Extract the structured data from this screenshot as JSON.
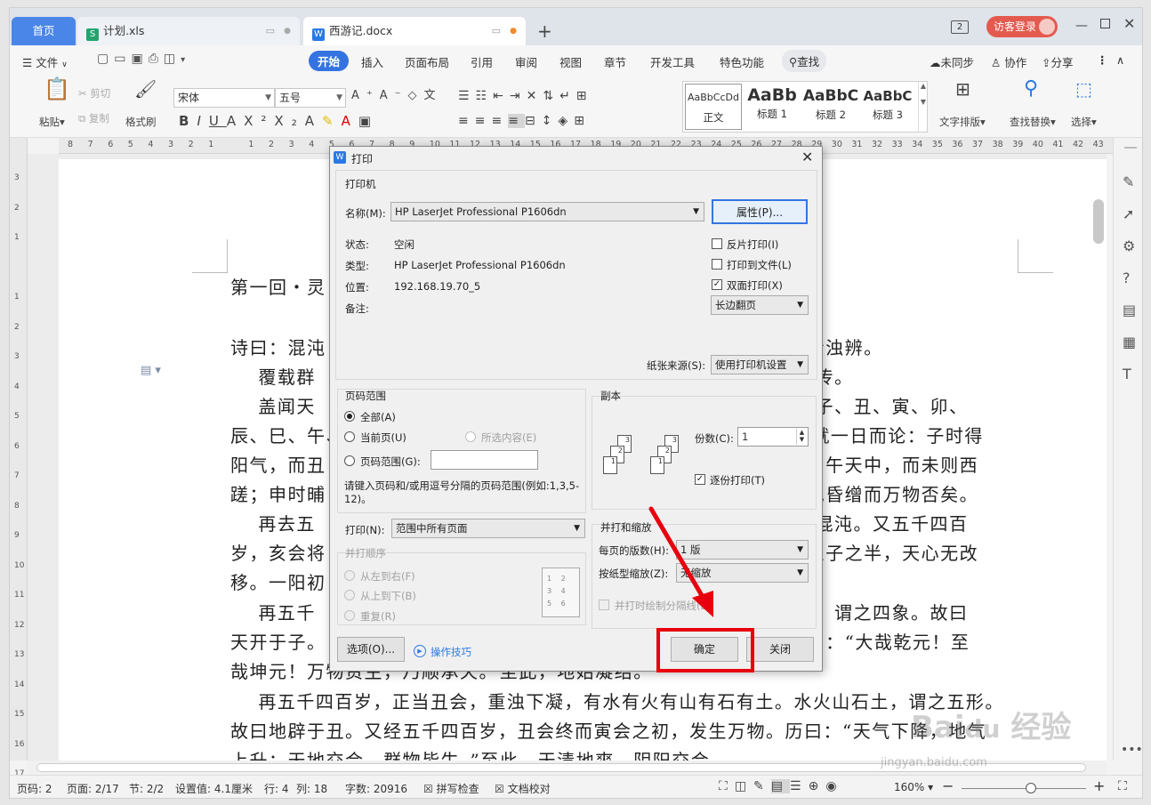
{
  "tabs": [
    {
      "label": "首页",
      "active": false
    },
    {
      "label": "计划.xls",
      "icon": "spreadsheet-icon"
    },
    {
      "label": "西游记.docx",
      "icon": "writer-icon",
      "active": true
    }
  ],
  "titlebar": {
    "badge": "2",
    "login_label": "访客登录"
  },
  "menu": {
    "file": "文件",
    "items": [
      "开始",
      "插入",
      "页面布局",
      "引用",
      "审阅",
      "视图",
      "章节",
      "开发工具",
      "特色功能"
    ],
    "search": "查找",
    "sync": "未同步",
    "collab": "协作",
    "share": "分享"
  },
  "ribbon": {
    "paste": "粘贴",
    "cut": "剪切",
    "copy": "复制",
    "format_painter": "格式刷",
    "font_name": "宋体",
    "font_size": "五号",
    "styles": [
      {
        "preview": "AaBbCcDd",
        "label": "正文"
      },
      {
        "preview": "AaBb",
        "label": "标题 1"
      },
      {
        "preview": "AaBbC",
        "label": "标题 2"
      },
      {
        "preview": "AaBbC",
        "label": "标题 3"
      }
    ],
    "text_layout": "文字排版",
    "find_replace": "查找替换",
    "select": "选择"
  },
  "ruler": {
    "marks": [
      "8",
      "7",
      "6",
      "5",
      "4",
      "3",
      "2",
      "1",
      "",
      "1",
      "2",
      "3",
      "4",
      "5",
      "6",
      "7",
      "8",
      "9",
      "10",
      "11",
      "12",
      "13",
      "14",
      "15",
      "16",
      "17",
      "18",
      "19",
      "20",
      "21",
      "22",
      "23",
      "24",
      "25",
      "26",
      "27",
      "28",
      "29",
      "30",
      "31",
      "32",
      "33",
      "34",
      "35",
      "36",
      "37",
      "38",
      "39",
      "40",
      "41",
      "42",
      "43"
    ],
    "vmarks": [
      "3",
      "2",
      "1",
      "",
      "1",
      "2",
      "3",
      "4",
      "5",
      "6",
      "7",
      "8",
      "9",
      "10",
      "11",
      "12",
      "13",
      "14",
      "15",
      "16",
      "17"
    ]
  },
  "document": {
    "lines": [
      "第一回・灵",
      "",
      "诗曰：混沌                                                                  兹清浊辨。",
      "    覆载群                                                                  释厄传。",
      "    盖闻天                                                                  ，乃子、丑、寅、卯、",
      "辰、巳、午、                                                                且就一日而论：子时得",
      "阳气，而丑                                                                  ；日午天中，而未则西",
      "蹉；申时晡                                                                  天地昏缯而万物否矣。",
      "    再去五                                                                  故曰混沌。又五千四百",
      "岁，亥会将                                                                  冬至子之半，天心无改",
      "移。一阳初",
      "    再五千                                                                  星辰，谓之四象。故曰",
      "天开于子。                                                                  》曰：“大哉乾元！至",
      "哉坤元！万物资生，乃顺承天。”至此，地始凝结。",
      "    再五千四百岁，正当丑会，重浊下凝，有水有火有山有石有土。水火山石土，谓之五形。",
      "故曰地辟于丑。又经五千四百岁，丑会终而寅会之初，发生万物。历曰：“天气下降，地气",
      "上升；天地交合，群物皆生。”至此，天清地爽，阴阳交合。"
    ]
  },
  "dialog": {
    "title": "打印",
    "printer_group": "打印机",
    "name_label": "名称(M):",
    "printer_name": "HP LaserJet Professional P1606dn",
    "properties_button": "属性(P)...",
    "status_label": "状态:",
    "status_value": "空闲",
    "type_label": "类型:",
    "type_value": "HP LaserJet Professional P1606dn",
    "location_label": "位置:",
    "location_value": "192.168.19.70_5",
    "comment_label": "备注:",
    "reverse_print": {
      "label": "反片打印(I)",
      "checked": false
    },
    "print_to_file": {
      "label": "打印到文件(L)",
      "checked": false
    },
    "duplex": {
      "label": "双面打印(X)",
      "checked": true
    },
    "flip_option": "长边翻页",
    "paper_source_label": "纸张来源(S):",
    "paper_source_value": "使用打印机设置",
    "page_range_group": "页码范围",
    "range_all": "全部(A)",
    "range_current": "当前页(U)",
    "range_selection": "所选内容(E)",
    "range_pages": "页码范围(G):",
    "range_hint": "请键入页码和/或用逗号分隔的页码范围(例如:1,3,5-12)。",
    "copies_group": "副本",
    "copies_label": "份数(C):",
    "copies_value": "1",
    "collate": {
      "label": "逐份打印(T)",
      "checked": true
    },
    "print_label": "打印(N):",
    "print_value": "范围中所有页面",
    "order_group": "并打顺序",
    "order_lr": "从左到右(F)",
    "order_tb": "从上到下(B)",
    "order_repeat": "重复(R)",
    "zoom_group": "并打和缩放",
    "pages_per_sheet_label": "每页的版数(H):",
    "pages_per_sheet_value": "1 版",
    "scale_label": "按纸型缩放(Z):",
    "scale_value": "无缩放",
    "draw_borders": "并打时绘制分隔线(D)",
    "options_button": "选项(O)...",
    "tips_link": "操作技巧",
    "ok_button": "确定",
    "close_button": "关闭"
  },
  "statusbar": {
    "page_no": "页码: 2",
    "pages": "页面: 2/17",
    "section": "节: 2/2",
    "setting": "设置值: 4.1厘米",
    "row": "行: 4",
    "col": "列: 18",
    "words": "字数: 20916",
    "spell": "拼写检查",
    "proof": "文档校对",
    "zoom": "160%"
  },
  "colors": {
    "accent": "#2b79e4",
    "highlight": "#e8000e",
    "tab_home": "#4a86e8"
  },
  "watermark": "Baidu经验 jingyan.baidu.com"
}
